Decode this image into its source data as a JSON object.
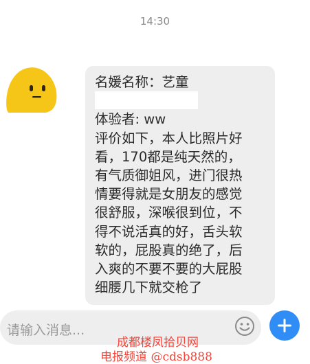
{
  "header": {
    "time": "14:30"
  },
  "message": {
    "lines": [
      "名媛名称：艺童",
      "",
      "体验者: ww",
      "评价如下，本人比照片好",
      "看，170都是纯天然的，",
      "有气质御姐风，进门很热",
      "情要得就是女朋友的感觉",
      "很舒服，深喉很到位，不",
      "得不说活真的好，舌头软",
      "软的，屁股真的绝了，后",
      "入爽的不要不要的大屁股",
      "细腰几下就交枪了"
    ]
  },
  "input": {
    "placeholder": "请输入消息..."
  },
  "watermark": {
    "line1": "成都楼凤拾贝网",
    "line2": "电报频道 @cdsb888"
  },
  "icons": {
    "emoji": "smiley-face-icon",
    "plus": "plus-icon",
    "avatar": "yellow-blob-avatar"
  },
  "colors": {
    "accent": "#2f8df5",
    "bubble": "#eeeeee",
    "watermark": "#f0453a",
    "avatar": "#f5c518"
  }
}
